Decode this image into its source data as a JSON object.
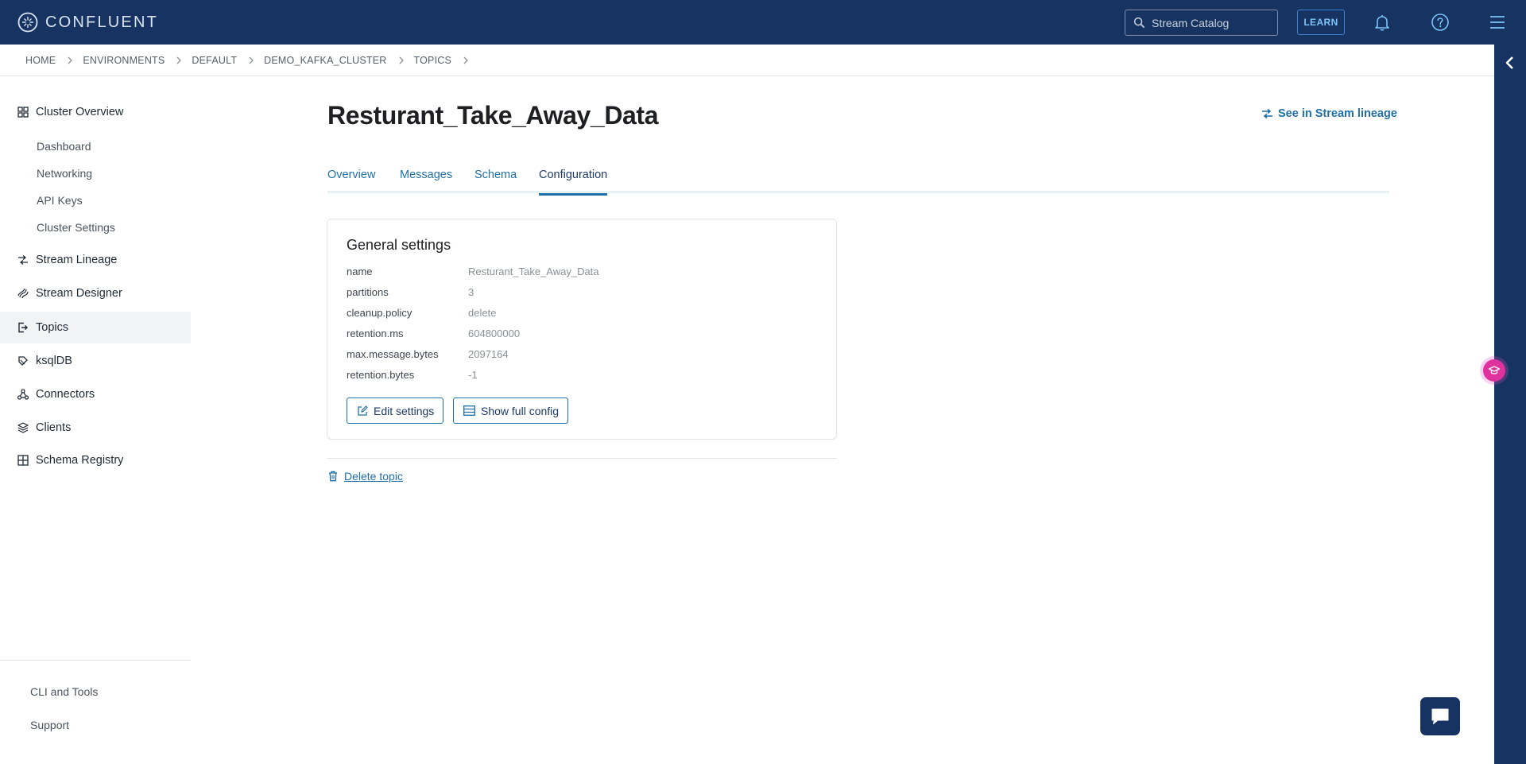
{
  "header": {
    "brand": "CONFLUENT",
    "search_placeholder": "Stream Catalog",
    "learn_label": "LEARN"
  },
  "breadcrumb": [
    "HOME",
    "ENVIRONMENTS",
    "DEFAULT",
    "DEMO_KAFKA_CLUSTER",
    "TOPICS"
  ],
  "sidebar": {
    "cluster_overview": "Cluster Overview",
    "sub_items": [
      "Dashboard",
      "Networking",
      "API Keys",
      "Cluster Settings"
    ],
    "items": [
      "Stream Lineage",
      "Stream Designer",
      "Topics",
      "ksqlDB",
      "Connectors",
      "Clients",
      "Schema Registry"
    ],
    "active_item": "Topics",
    "footer": [
      "CLI and Tools",
      "Support"
    ]
  },
  "main": {
    "title": "Resturant_Take_Away_Data",
    "lineage_link": "See in Stream lineage",
    "tabs": [
      "Overview",
      "Messages",
      "Schema",
      "Configuration"
    ],
    "active_tab": "Configuration",
    "general_settings": {
      "title": "General settings",
      "rows": [
        {
          "key": "name",
          "value": "Resturant_Take_Away_Data"
        },
        {
          "key": "partitions",
          "value": "3"
        },
        {
          "key": "cleanup.policy",
          "value": "delete"
        },
        {
          "key": "retention.ms",
          "value": "604800000"
        },
        {
          "key": "max.message.bytes",
          "value": "2097164"
        },
        {
          "key": "retention.bytes",
          "value": "-1"
        }
      ],
      "edit_label": "Edit settings",
      "show_full_label": "Show full config"
    },
    "delete_label": "Delete topic"
  },
  "colors": {
    "topbar": "#173361",
    "link": "#1f6fa8",
    "accent_pink": "#e0329f"
  }
}
